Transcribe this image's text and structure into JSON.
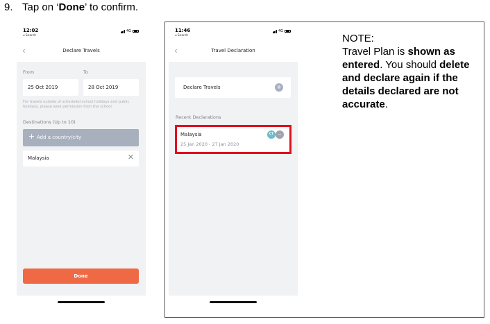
{
  "step": {
    "number": "9.",
    "pre": "Tap on ‘",
    "bold": "Done",
    "post": "’ to confirm."
  },
  "screen1": {
    "status": {
      "time": "12:02",
      "back_app": "◂ Search",
      "network": "4G"
    },
    "nav": {
      "back_icon": "chevron-left-icon",
      "title": "Declare Travels"
    },
    "from_label": "From",
    "to_label": "To",
    "from_value": "25 Oct 2019",
    "to_value": "28 Oct 2019",
    "hint": "For travels outside of scheduled school holidays and public holidays, please seek permission from the school.",
    "destinations_label": "Destinations (Up to 10)",
    "add_country_label": "Add a country/city",
    "destination_value": "Malaysia",
    "done_label": "Done",
    "colors": {
      "accent": "#ef6a44",
      "disabled": "#a8b0be",
      "background": "#f1f2f4"
    }
  },
  "screen2": {
    "status": {
      "time": "11:46",
      "back_app": "◂ Search",
      "network": "4G"
    },
    "nav": {
      "back_icon": "chevron-left-icon",
      "title": "Travel Declaration"
    },
    "declare_label": "Declare Travels",
    "recent_label": "Recent Declarations",
    "recent": [
      {
        "country": "Malaysia",
        "dates": "25 Jan 2020 - 27 Jan 2020",
        "avatars": [
          "CT",
          "..."
        ]
      }
    ],
    "colors": {
      "highlight": "#e0101b",
      "avatar1": "#6fbccb",
      "avatar2": "#9fa4ab"
    }
  },
  "note": {
    "heading": "NOTE:",
    "line1_a": "Travel Plan is ",
    "line1_b": "shown as entered",
    "line1_c": ". You should ",
    "line1_d": "delete and declare again if the details declared are not accurate",
    "line1_e": "."
  }
}
